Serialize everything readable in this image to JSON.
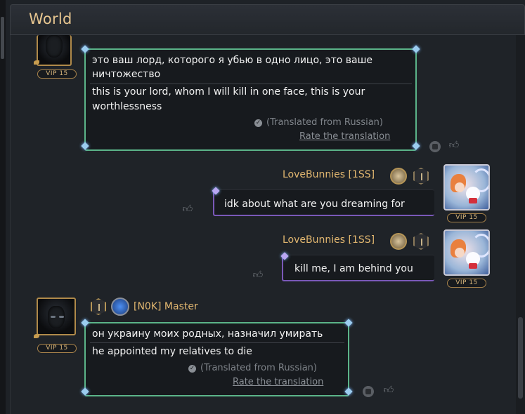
{
  "window": {
    "title": "World"
  },
  "vip_label": "VIP 15",
  "messages": [
    {
      "sender": "",
      "text_original": "это ваш лорд, которого я убью в одно лицо, это ваше\nничтожество",
      "line1": "это ваш лорд, которого я убью в одно лицо, это ваше",
      "line2": "ничтожество",
      "translation_line1": "this is your lord, whom I will kill in one face, this is your",
      "translation_line2": "worthlessness",
      "translated_from": "(Translated from Russian)",
      "rate_label": "Rate the translation"
    },
    {
      "sender": "LoveBunnies [1SS]",
      "text": "idk about what are you dreaming for"
    },
    {
      "sender": "LoveBunnies [1SS]",
      "text": "kill me, I am behind you"
    },
    {
      "sender": "[N0K] Master",
      "line1": "он украину моих родных, назначил умирать",
      "translation_line1": "he appointed my relatives to die",
      "translated_from": "(Translated from Russian)",
      "rate_label": "Rate the translation"
    }
  ],
  "icons": {
    "like": "thumbs-up-icon",
    "copy": "copy-icon",
    "check": "check-icon"
  },
  "colors": {
    "accent_gold": "#e2b770",
    "bubble_green": "#5bb489",
    "bubble_purple": "#7a58b8"
  }
}
